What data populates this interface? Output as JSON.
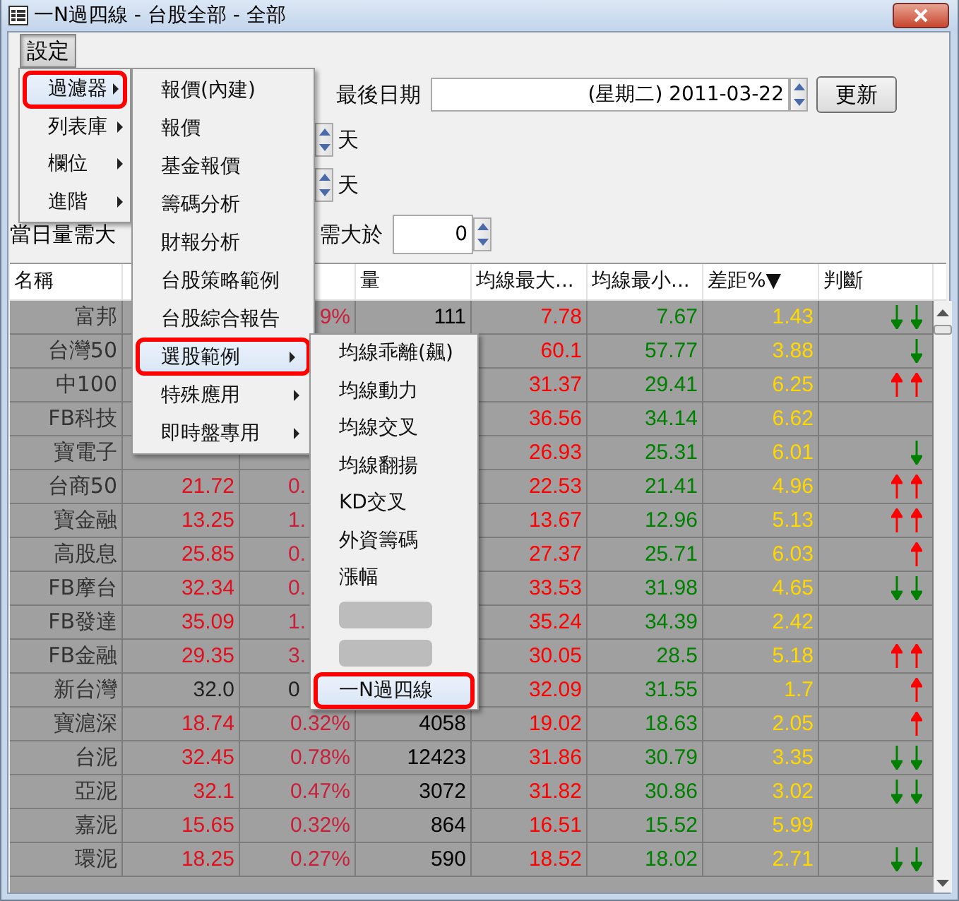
{
  "window": {
    "title": "一N過四線 - 台股全部 - 全部"
  },
  "menubar": [
    {
      "label": "設定",
      "open": true
    }
  ],
  "filters": {
    "date_label": "最後日期",
    "date_value": "(星期二) 2011-03-22",
    "update_button": "更新",
    "day_rows": [
      {
        "unit": "天"
      },
      {
        "unit": "天"
      }
    ],
    "volume_label": "當日量需大",
    "price_label": "需大於",
    "price_value": "0"
  },
  "table": {
    "headers": {
      "name": "名稱",
      "volume": "量",
      "ma_max": "均線最大...",
      "ma_min": "均線最小...",
      "diff": "差距%▼",
      "judgement": "判斷"
    },
    "rows": [
      {
        "name": "富邦",
        "change": "9%",
        "rising": true,
        "volume": "111",
        "ma_max": "7.78",
        "ma_min": "7.67",
        "diff": "1.43",
        "signals": [
          {
            "up": false
          },
          {
            "up": false
          }
        ]
      },
      {
        "name": "台灣50",
        "ma_max": "60.1",
        "ma_min": "57.77",
        "diff": "3.88",
        "signals": [
          {
            "up": false
          }
        ]
      },
      {
        "name": "中100",
        "ma_max": "31.37",
        "ma_min": "29.41",
        "diff": "6.25",
        "signals": [
          {
            "up": true
          },
          {
            "up": true
          }
        ]
      },
      {
        "name": "FB科技",
        "ma_max": "36.56",
        "ma_min": "34.14",
        "diff": "6.62",
        "signals": []
      },
      {
        "name": "寶電子",
        "ma_max": "26.93",
        "ma_min": "25.31",
        "diff": "6.01",
        "signals": [
          {
            "up": false
          }
        ]
      },
      {
        "name": "台商50",
        "price": "21.72",
        "change": "0.",
        "rising": true,
        "ma_max": "22.53",
        "ma_min": "21.41",
        "diff": "4.96",
        "signals": [
          {
            "up": true
          },
          {
            "up": true
          }
        ]
      },
      {
        "name": "寶金融",
        "price": "13.25",
        "change": "1.",
        "rising": true,
        "ma_max": "13.67",
        "ma_min": "12.96",
        "diff": "5.13",
        "signals": [
          {
            "up": true
          },
          {
            "up": true
          }
        ]
      },
      {
        "name": "高股息",
        "price": "25.85",
        "change": "0.",
        "rising": true,
        "ma_max": "27.37",
        "ma_min": "25.71",
        "diff": "6.03",
        "signals": [
          {
            "up": true
          }
        ]
      },
      {
        "name": "FB摩台",
        "price": "32.34",
        "change": "0.",
        "rising": true,
        "ma_max": "33.53",
        "ma_min": "31.98",
        "diff": "4.65",
        "signals": [
          {
            "up": false
          },
          {
            "up": false
          }
        ]
      },
      {
        "name": "FB發達",
        "price": "35.09",
        "change": "1.",
        "rising": true,
        "ma_max": "35.24",
        "ma_min": "34.39",
        "diff": "2.42",
        "signals": []
      },
      {
        "name": "FB金融",
        "price": "29.35",
        "change": "3.",
        "rising": true,
        "ma_max": "30.05",
        "ma_min": "28.5",
        "diff": "5.18",
        "signals": [
          {
            "up": true
          },
          {
            "up": true
          }
        ]
      },
      {
        "name": "新台灣",
        "price": "32.0",
        "change": "0",
        "rising": false,
        "ma_max": "32.09",
        "ma_min": "31.55",
        "diff": "1.7",
        "signals": [
          {
            "up": true
          }
        ]
      },
      {
        "name": "寶滬深",
        "price": "18.74",
        "change": "0.32%",
        "rising": true,
        "volume": "4058",
        "ma_max": "19.02",
        "ma_min": "18.63",
        "diff": "2.05",
        "signals": [
          {
            "up": true
          }
        ]
      },
      {
        "name": "台泥",
        "price": "32.45",
        "change": "0.78%",
        "rising": true,
        "volume": "12423",
        "ma_max": "31.86",
        "ma_min": "30.79",
        "diff": "3.35",
        "signals": [
          {
            "up": false
          },
          {
            "up": false
          }
        ]
      },
      {
        "name": "亞泥",
        "price": "32.1",
        "change": "0.47%",
        "rising": true,
        "volume": "3072",
        "ma_max": "31.82",
        "ma_min": "30.86",
        "diff": "3.02",
        "signals": [
          {
            "up": false
          },
          {
            "up": false
          }
        ]
      },
      {
        "name": "嘉泥",
        "price": "15.65",
        "change": "0.32%",
        "rising": true,
        "volume": "864",
        "ma_max": "16.51",
        "ma_min": "15.52",
        "diff": "5.99",
        "signals": []
      },
      {
        "name": "環泥",
        "price": "18.25",
        "change": "0.27%",
        "rising": true,
        "volume": "590",
        "ma_max": "18.52",
        "ma_min": "18.02",
        "diff": "2.71",
        "signals": [
          {
            "up": false
          },
          {
            "up": false
          }
        ]
      }
    ]
  },
  "menus": [
    {
      "items": [
        {
          "kind": "item",
          "label": "過濾器",
          "selected": true,
          "submenu": true
        },
        {
          "kind": "item",
          "label": "列表庫",
          "selected": false,
          "submenu": true
        },
        {
          "kind": "item",
          "label": "欄位",
          "selected": false,
          "submenu": true
        },
        {
          "kind": "item",
          "label": "進階",
          "selected": false,
          "submenu": true
        }
      ]
    },
    {
      "items": [
        {
          "kind": "item",
          "label": "報價(內建)",
          "selected": false,
          "submenu": false
        },
        {
          "kind": "item",
          "label": "報價",
          "selected": false,
          "submenu": false
        },
        {
          "kind": "item",
          "label": "基金報價",
          "selected": false,
          "submenu": false
        },
        {
          "kind": "item",
          "label": "籌碼分析",
          "selected": false,
          "submenu": false
        },
        {
          "kind": "item",
          "label": "財報分析",
          "selected": false,
          "submenu": false
        },
        {
          "kind": "item",
          "label": "台股策略範例",
          "selected": false,
          "submenu": false
        },
        {
          "kind": "item",
          "label": "台股綜合報告",
          "selected": false,
          "submenu": false
        },
        {
          "kind": "item",
          "label": "選股範例",
          "selected": true,
          "submenu": true
        },
        {
          "kind": "item",
          "label": "特殊應用",
          "selected": false,
          "submenu": true
        },
        {
          "kind": "item",
          "label": "即時盤專用",
          "selected": false,
          "submenu": true
        }
      ]
    },
    {
      "items": [
        {
          "kind": "item",
          "label": "均線乖離(飆)",
          "selected": false,
          "submenu": false
        },
        {
          "kind": "item",
          "label": "均線動力",
          "selected": false,
          "submenu": false
        },
        {
          "kind": "item",
          "label": "均線交叉",
          "selected": false,
          "submenu": false
        },
        {
          "kind": "item",
          "label": "均線翻揚",
          "selected": false,
          "submenu": false
        },
        {
          "kind": "item",
          "label": "KD交叉",
          "selected": false,
          "submenu": false
        },
        {
          "kind": "item",
          "label": "外資籌碼",
          "selected": false,
          "submenu": false
        },
        {
          "kind": "item",
          "label": "漲幅",
          "selected": false,
          "submenu": false
        },
        {
          "kind": "redacted",
          "selected": false
        },
        {
          "kind": "redacted",
          "selected": false
        },
        {
          "kind": "item",
          "label": "一N過四線",
          "selected": true,
          "submenu": false
        }
      ]
    }
  ]
}
